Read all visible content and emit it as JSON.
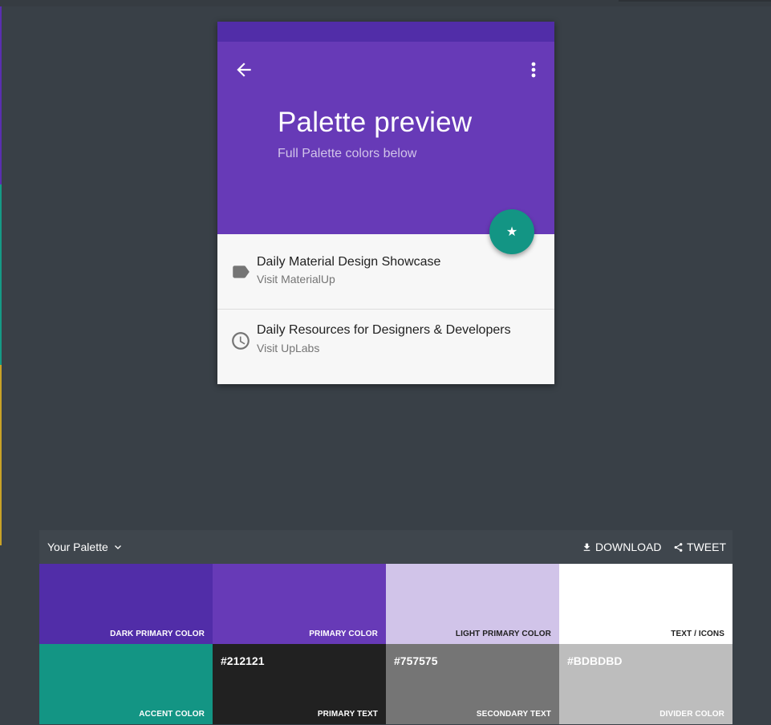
{
  "preview": {
    "title": "Palette preview",
    "subtitle": "Full Palette colors below",
    "back_icon": "arrow-back-icon",
    "more_icon": "more-vert-icon",
    "fab_icon": "star-icon",
    "fab_glyph": "★",
    "list": [
      {
        "icon": "label-icon",
        "primary": "Daily Material Design Showcase",
        "secondary": "Visit MaterialUp"
      },
      {
        "icon": "clock-icon",
        "primary": "Daily Resources for Designers & Developers",
        "secondary": "Visit UpLabs"
      }
    ]
  },
  "palette": {
    "title": "Your Palette",
    "download_label": "DOWNLOAD",
    "tweet_label": "TWEET",
    "swatches": [
      {
        "label": "DARK PRIMARY COLOR",
        "hex": "",
        "color": "#512da8",
        "text_color": "#ffffff"
      },
      {
        "label": "PRIMARY COLOR",
        "hex": "",
        "color": "#673ab7",
        "text_color": "#ffffff"
      },
      {
        "label": "LIGHT PRIMARY COLOR",
        "hex": "",
        "color": "#d1c4e9",
        "text_color": "#212121"
      },
      {
        "label": "TEXT / ICONS",
        "hex": "",
        "color": "#ffffff",
        "text_color": "#212121"
      },
      {
        "label": "ACCENT COLOR",
        "hex": "",
        "color": "#139584",
        "text_color": "#ffffff"
      },
      {
        "label": "PRIMARY TEXT",
        "hex": "#212121",
        "color": "#212121",
        "text_color": "#ffffff"
      },
      {
        "label": "SECONDARY TEXT",
        "hex": "#757575",
        "color": "#757575",
        "text_color": "#ffffff"
      },
      {
        "label": "DIVIDER COLOR",
        "hex": "#BDBDBD",
        "color": "#bdbdbd",
        "text_color": "#ffffff"
      }
    ]
  },
  "colors": {
    "background": "#394047",
    "dark_primary": "#512da8",
    "primary": "#673ab7",
    "accent": "#139584",
    "list_icon": "#757575"
  }
}
